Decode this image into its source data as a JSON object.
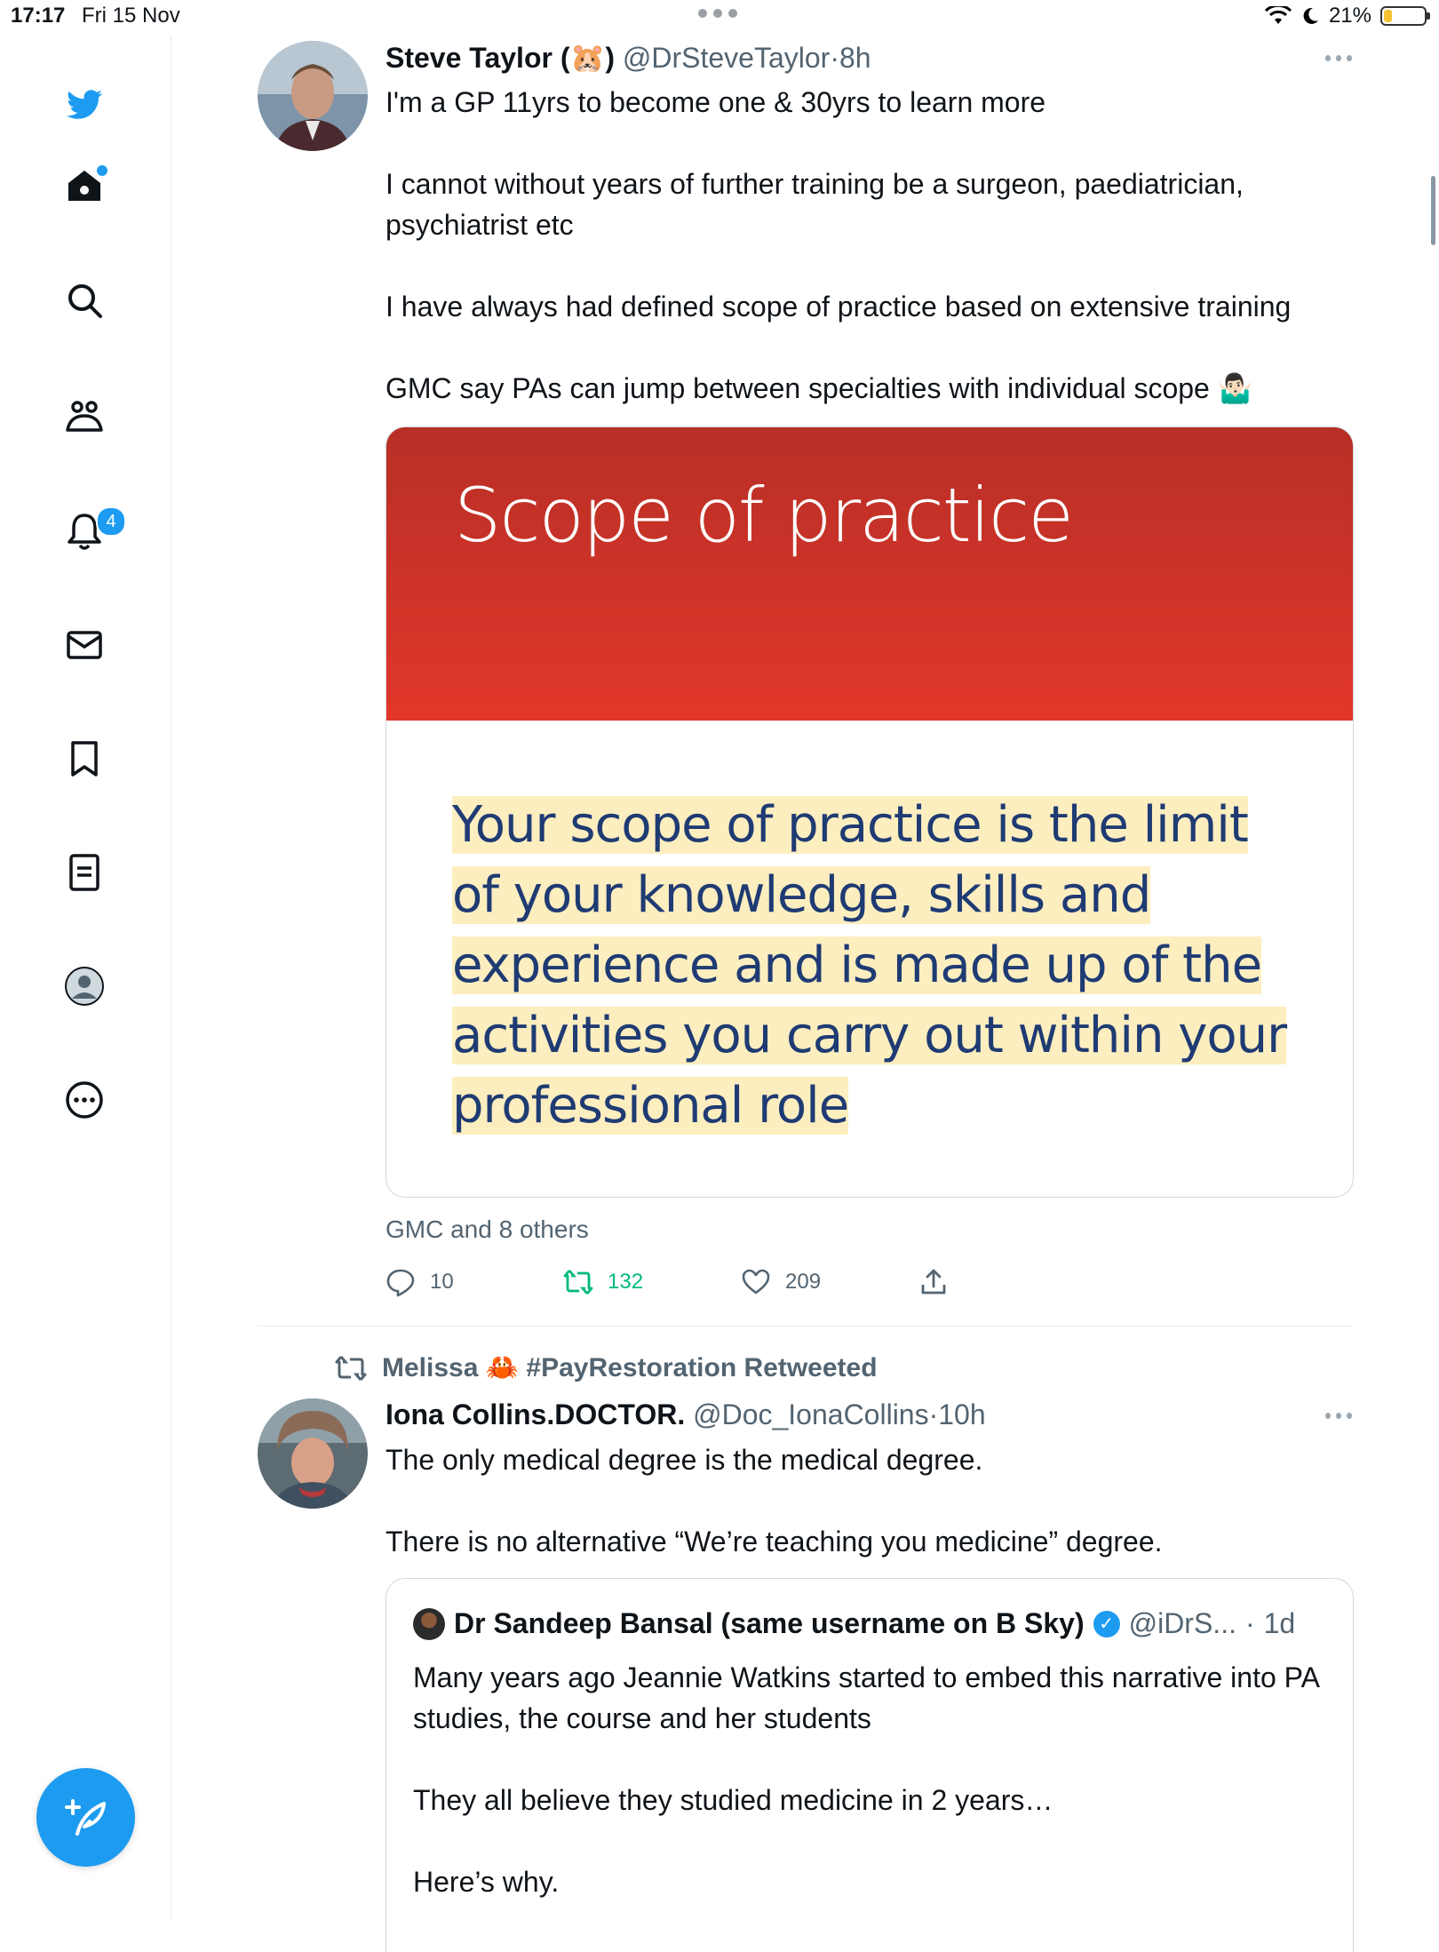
{
  "status_bar": {
    "time": "17:17",
    "date": "Fri 15 Nov",
    "battery": "21%",
    "battery_level": 0.21
  },
  "sidebar": {
    "notifications_badge": "4",
    "icons": [
      "twitter-logo-icon",
      "home-icon",
      "search-icon",
      "communities-icon",
      "notifications-icon",
      "messages-icon",
      "bookmarks-icon",
      "lists-icon",
      "profile-icon",
      "more-icon"
    ]
  },
  "tweet1": {
    "name": "Steve Taylor (",
    "emoji": "🐹",
    "name_end": ")",
    "handle": "@DrSteveTaylor",
    "sep": "·",
    "time": "8h",
    "lines": [
      "I'm a GP 11yrs to become one & 30yrs to learn more",
      "I cannot without years of further training be a surgeon, paediatrician, psychiatrist etc",
      "I have always had defined scope of practice based on extensive training",
      "GMC say PAs can jump between specialties with individual scope 🤷🏻‍♂️"
    ],
    "media_title": "Scope of practice",
    "media_quote": "Your scope of practice is the limit of your knowledge, skills and experience and is made up of the activities you carry out within your professional role",
    "tagged": "GMC and 8 others",
    "replies": "10",
    "retweets": "132",
    "likes": "209"
  },
  "tweet2": {
    "retweeted_by": "Melissa 🦀 #PayRestoration Retweeted",
    "name": "Iona Collins.DOCTOR.",
    "handle": "@Doc_IonaCollins",
    "sep": "·",
    "time": "10h",
    "lines": [
      "The only medical degree is the medical degree.",
      "There is no alternative “We’re teaching you medicine” degree."
    ],
    "quoted": {
      "name": "Dr Sandeep Bansal (same username on B Sky)",
      "handle": "@iDrS...",
      "sep": "·",
      "time": "1d",
      "lines": [
        "Many years ago Jeannie Watkins started to embed this narrative into PA studies, the course and her students",
        "They all believe they studied medicine in 2 years…",
        "Here’s why."
      ]
    }
  },
  "colors": {
    "accent": "#1d9bf0",
    "retweet": "#00ba7c",
    "media_red": "#d3342a",
    "highlight": "#fdeec0"
  }
}
